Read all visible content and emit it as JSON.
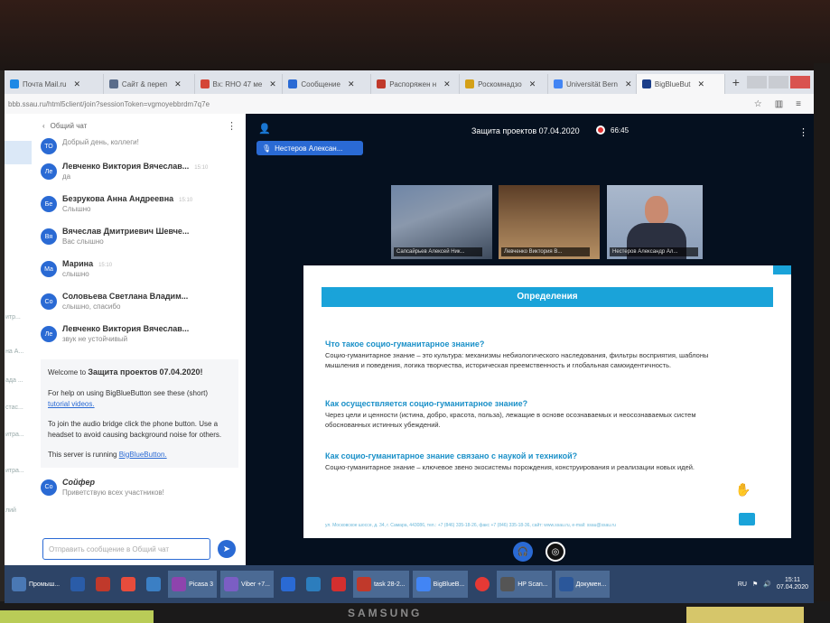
{
  "browser": {
    "tabs": [
      {
        "label": "Почта Mail.ru",
        "color": "#1e88e5"
      },
      {
        "label": "Сайт & переп",
        "color": "#5a6c8a"
      },
      {
        "label": "Вх: RHO 47 ме",
        "color": "#d44638"
      },
      {
        "label": "Сообщение",
        "color": "#2a6ad4"
      },
      {
        "label": "Распоряжен н",
        "color": "#c0392b"
      },
      {
        "label": "Роскомнадзо",
        "color": "#d4a017"
      },
      {
        "label": "Universität Bern",
        "color": "#4285f4"
      },
      {
        "label": "BigBlueBut",
        "color": "#1b3e8a"
      }
    ],
    "url": "bbb.ssau.ru/html5client/join?sessionToken=vgmoyebbrdm7q7e"
  },
  "left_strip_labels": [
    "итр...",
    "на А...",
    "ада ...",
    "стас...",
    "итра...",
    "итра...",
    "лий"
  ],
  "chat": {
    "header": "Общий чат",
    "messages": [
      {
        "initials": "ТО",
        "name": "",
        "time": "",
        "text": "Добрый день, коллеги!"
      },
      {
        "initials": "Ле",
        "name": "Левченко Виктория Вячеслав...",
        "time": "15:10",
        "text": "да"
      },
      {
        "initials": "Бе",
        "name": "Безрукова Анна Андреевна",
        "time": "15:10",
        "text": "Слышно"
      },
      {
        "initials": "Вя",
        "name": "Вячеслав Дмитриевич Шевче...",
        "time": "",
        "text": "Вас слышно"
      },
      {
        "initials": "Ма",
        "name": "Марина",
        "time": "15:10",
        "text": "слышно"
      },
      {
        "initials": "Со",
        "name": "Соловьева Светлана Владим...",
        "time": "",
        "text": "слышно, спасибо"
      },
      {
        "initials": "Ле",
        "name": "Левченко Виктория Вячеслав...",
        "time": "",
        "text": "звук не устойчивый"
      }
    ],
    "welcome_prefix": "Welcome to",
    "welcome_title": "Защита проектов",
    "welcome_date": "07.04.2020!",
    "help_prefix": "For help on using BigBlueButton see these (short)",
    "help_link": "tutorial videos.",
    "audio_tip": "To join the audio bridge click the phone button. Use a headset to avoid causing background noise for others.",
    "server_prefix": "This server is running",
    "server_link": "BigBlueButton.",
    "last_message": {
      "initials": "Со",
      "name": "Сойфер",
      "text": "Приветствую всех участников!"
    },
    "input_placeholder": "Отправить сообщение в Общий чат"
  },
  "stage": {
    "session_title": "Защита проектов 07.04.2020",
    "timer": "66:45",
    "presenter": "Нестеров Алексан...",
    "video_tiles": [
      "Сапсайрьев Алексей Ник...",
      "Левченко Виктория В...",
      "Нестеров Александр Ал..."
    ]
  },
  "slide": {
    "title": "Определения",
    "q1": "Что такое социо-гуманитарное знание?",
    "a1": "Социо-гуманитарное знание – это культура: механизмы небиологического наследования, фильтры восприятия, шаблоны мышления и поведения, логика творчества, историческая преемственность и глобальная самоидентичность.",
    "q2": "Как осуществляется социо-гуманитарное знание?",
    "a2": "Через цели и ценности (истина, добро, красота, польза), лежащие в основе осознаваемых и неосознаваемых систем обоснованных истинных убеждений.",
    "q3": "Как социо-гуманитарное знание связано с наукой и техникой?",
    "a3": "Социо-гуманитарное знание – ключевое звено экосистемы порождения, конструирования и реализации новых идей.",
    "footer": "ул. Московское шоссе, д. 34, г. Самара, 443086, тел.: +7 (846) 335-18-26, факс +7 (846) 335-18-36, сайт: www.ssau.ru, e-mail: ssau@ssau.ru"
  },
  "taskbar": {
    "items": [
      {
        "label": "Промыш...",
        "color": "#4a78b4"
      },
      {
        "label": "",
        "color": "#2a5ca8"
      },
      {
        "label": "",
        "color": "#c0392b"
      },
      {
        "label": "",
        "color": "#e74c3c"
      },
      {
        "label": "",
        "color": "#3b7fc4"
      },
      {
        "label": "Picasa 3",
        "color": "#8e44ad"
      },
      {
        "label": "Viber +7...",
        "color": "#7b5ec4"
      },
      {
        "label": "",
        "color": "#2a6ad4"
      },
      {
        "label": "",
        "color": "#2c7dbd"
      },
      {
        "label": "",
        "color": "#d32f2f"
      },
      {
        "label": "task 28-2...",
        "color": "#c0392b"
      },
      {
        "label": "BigBlueB...",
        "color": "#4285f4"
      },
      {
        "label": "",
        "color": "#e53935"
      },
      {
        "label": "HP Scan...",
        "color": "#555555"
      },
      {
        "label": "Докумен...",
        "color": "#2b579a"
      }
    ],
    "lang": "RU",
    "time": "15:11",
    "date": "07.04.2020"
  },
  "brand": "SAMSUNG"
}
